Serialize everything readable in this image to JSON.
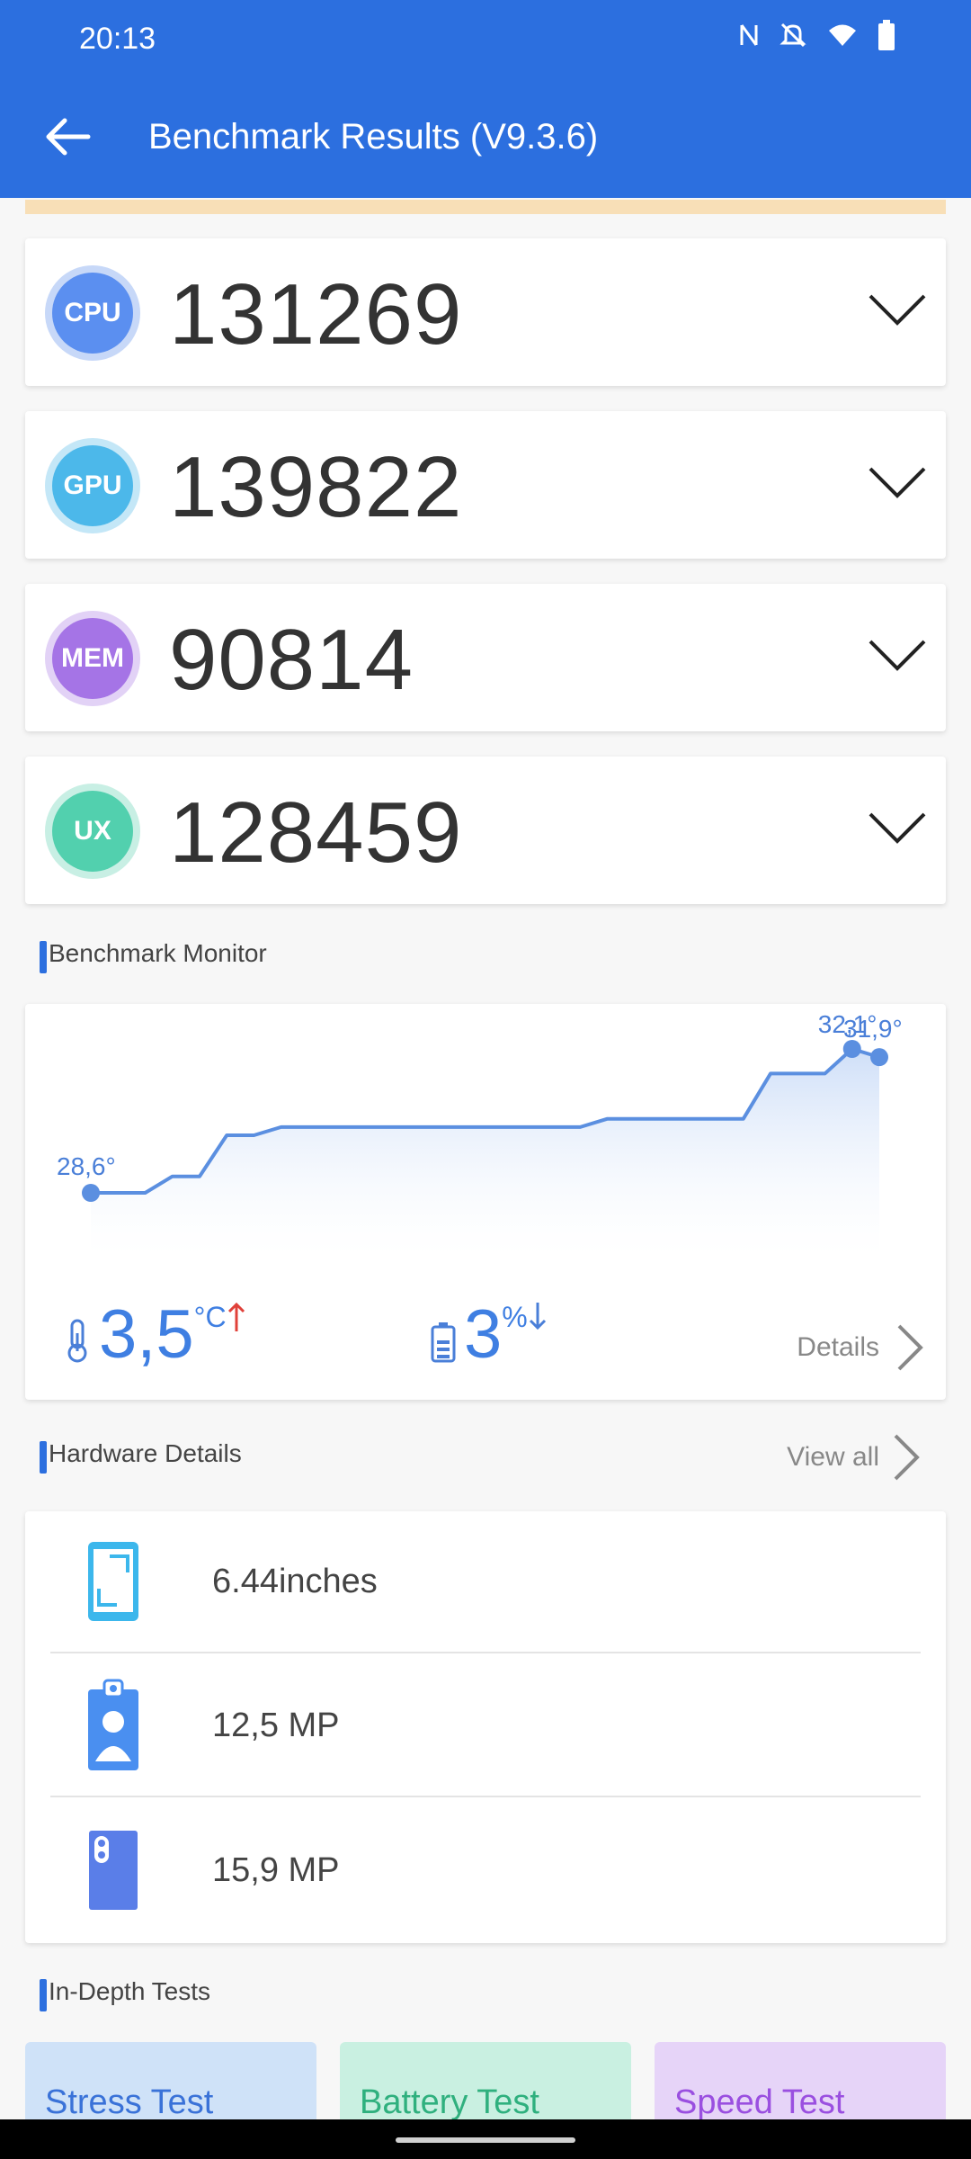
{
  "status_bar": {
    "time": "20:13",
    "icons": [
      "nfc-icon",
      "mute-icon",
      "wifi-icon",
      "battery-icon"
    ]
  },
  "header": {
    "title": "Benchmark Results (V9.3.6)"
  },
  "scores": [
    {
      "badge": "CPU",
      "value": "131269",
      "color": "#5b8ff0",
      "ring": "#c7d8f8"
    },
    {
      "badge": "GPU",
      "value": "139822",
      "color": "#4cb8ea",
      "ring": "#c4e7f7"
    },
    {
      "badge": "MEM",
      "value": "90814",
      "color": "#a574e6",
      "ring": "#e2d2f6"
    },
    {
      "badge": "UX",
      "value": "128459",
      "color": "#52d0ae",
      "ring": "#c8efe4"
    }
  ],
  "monitor": {
    "section_title": "Benchmark Monitor",
    "temp_delta": "3,5",
    "temp_unit": "°C",
    "battery_delta": "3",
    "battery_unit": "%",
    "details_label": "Details",
    "chart_data": {
      "type": "area",
      "start_label": "28,6°",
      "end_labels": [
        "32,1°",
        "31,9°"
      ],
      "values": [
        28.6,
        28.6,
        28.6,
        29.0,
        29.0,
        30.0,
        30.0,
        30.2,
        30.2,
        30.2,
        30.2,
        30.2,
        30.2,
        30.2,
        30.2,
        30.2,
        30.2,
        30.2,
        30.2,
        30.4,
        30.4,
        30.4,
        30.4,
        30.4,
        30.4,
        31.5,
        31.5,
        31.5,
        32.1,
        31.9
      ]
    }
  },
  "hardware": {
    "section_title": "Hardware Details",
    "view_all_label": "View all",
    "items": [
      {
        "icon": "screen-size-icon",
        "label": "6.44inches"
      },
      {
        "icon": "front-camera-icon",
        "label": "12,5 MP"
      },
      {
        "icon": "rear-camera-icon",
        "label": "15,9 MP"
      }
    ]
  },
  "in_depth": {
    "section_title": "In-Depth Tests",
    "tests": [
      {
        "label": "Stress Test",
        "color": "#3a72d8",
        "bg": "#cfe2f8"
      },
      {
        "label": "Battery Test",
        "color": "#2fb07e",
        "bg": "#c9f0e1"
      },
      {
        "label": "Speed Test",
        "color": "#9a4fe0",
        "bg": "#e6d4f8"
      }
    ]
  }
}
